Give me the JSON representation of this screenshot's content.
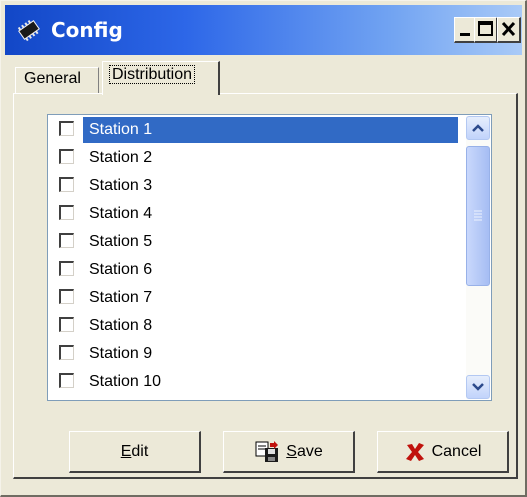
{
  "window": {
    "title": "Config"
  },
  "tabs": [
    {
      "label": "General"
    },
    {
      "label": "Distribution"
    }
  ],
  "station_list": {
    "items": [
      {
        "label": "Station 1",
        "checked": false,
        "selected": true
      },
      {
        "label": "Station 2",
        "checked": false
      },
      {
        "label": "Station 3",
        "checked": false
      },
      {
        "label": "Station 4",
        "checked": false
      },
      {
        "label": "Station 5",
        "checked": false
      },
      {
        "label": "Station 6",
        "checked": false
      },
      {
        "label": "Station 7",
        "checked": false
      },
      {
        "label": "Station 8",
        "checked": false
      },
      {
        "label": "Station 9",
        "checked": false
      },
      {
        "label": "Station 10",
        "checked": false
      }
    ]
  },
  "buttons": {
    "edit": {
      "label_first": "E",
      "label_rest": "dit"
    },
    "save": {
      "label_first": "S",
      "label_rest": "ave",
      "icon": "save-icon"
    },
    "cancel": {
      "label": "Cancel",
      "icon": "cancel-x-icon"
    }
  },
  "colors": {
    "selection": "#316ac5",
    "titlebar": "#1247c7",
    "cancel_x": "#c0120c"
  }
}
